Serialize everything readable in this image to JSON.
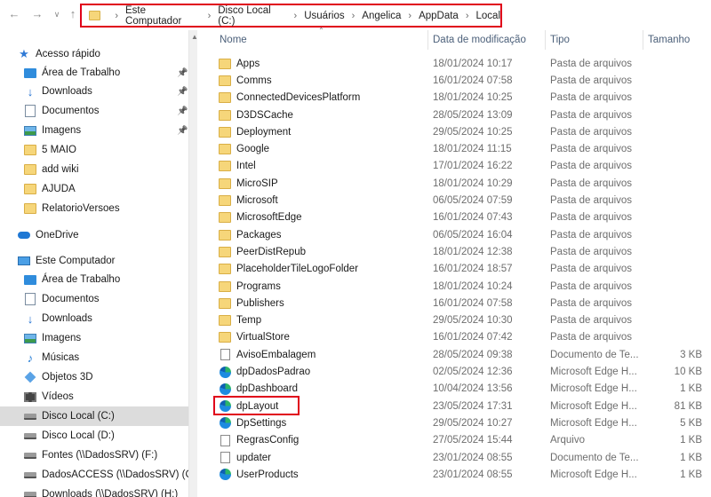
{
  "address": {
    "crumbs": [
      "Este Computador",
      "Disco Local (C:)",
      "Usuários",
      "Angelica",
      "AppData",
      "Local"
    ]
  },
  "nav": {
    "items": [
      {
        "label": "Acesso rápido",
        "icon": "star-icon",
        "indent": 0,
        "pinned": false
      },
      {
        "label": "Área de Trabalho",
        "icon": "desktop-icon",
        "indent": 1,
        "pinned": true
      },
      {
        "label": "Downloads",
        "icon": "downloads-icon",
        "indent": 1,
        "pinned": true
      },
      {
        "label": "Documentos",
        "icon": "documents-icon",
        "indent": 1,
        "pinned": true
      },
      {
        "label": "Imagens",
        "icon": "pictures-icon",
        "indent": 1,
        "pinned": true
      },
      {
        "label": "5 MAIO",
        "icon": "folder-icon",
        "indent": 1,
        "pinned": false
      },
      {
        "label": "add wiki",
        "icon": "folder-icon",
        "indent": 1,
        "pinned": false
      },
      {
        "label": "AJUDA",
        "icon": "folder-icon",
        "indent": 1,
        "pinned": false
      },
      {
        "label": "RelatorioVersoes",
        "icon": "folder-icon",
        "indent": 1,
        "pinned": false
      },
      {
        "label": "OneDrive",
        "icon": "onedrive-icon",
        "indent": 0,
        "pinned": false
      },
      {
        "label": "Este Computador",
        "icon": "computer-icon",
        "indent": 0,
        "pinned": false
      },
      {
        "label": "Área de Trabalho",
        "icon": "desktop-icon",
        "indent": 1,
        "pinned": false
      },
      {
        "label": "Documentos",
        "icon": "documents-icon",
        "indent": 1,
        "pinned": false
      },
      {
        "label": "Downloads",
        "icon": "downloads-icon",
        "indent": 1,
        "pinned": false
      },
      {
        "label": "Imagens",
        "icon": "pictures-icon",
        "indent": 1,
        "pinned": false
      },
      {
        "label": "Músicas",
        "icon": "music-icon",
        "indent": 1,
        "pinned": false
      },
      {
        "label": "Objetos 3D",
        "icon": "objects-3d-icon",
        "indent": 1,
        "pinned": false
      },
      {
        "label": "Vídeos",
        "icon": "videos-icon",
        "indent": 1,
        "pinned": false
      },
      {
        "label": "Disco Local (C:)",
        "icon": "drive-icon",
        "indent": 1,
        "pinned": false,
        "selected": true
      },
      {
        "label": "Disco Local (D:)",
        "icon": "drive-icon",
        "indent": 1,
        "pinned": false
      },
      {
        "label": "Fontes (\\\\DadosSRV) (F:)",
        "icon": "network-drive-icon",
        "indent": 1,
        "pinned": false
      },
      {
        "label": "DadosACCESS (\\\\DadosSRV) (G:)",
        "icon": "network-drive-icon",
        "indent": 1,
        "pinned": false
      },
      {
        "label": "Downloads (\\\\DadosSRV) (H:)",
        "icon": "network-drive-icon",
        "indent": 1,
        "pinned": false
      }
    ]
  },
  "columns": {
    "name": "Nome",
    "date": "Data de modificação",
    "type": "Tipo",
    "size": "Tamanho"
  },
  "files": [
    {
      "name": "Apps",
      "date": "18/01/2024 10:17",
      "type": "Pasta de arquivos",
      "size": "",
      "icon": "folder-icon"
    },
    {
      "name": "Comms",
      "date": "16/01/2024 07:58",
      "type": "Pasta de arquivos",
      "size": "",
      "icon": "folder-icon"
    },
    {
      "name": "ConnectedDevicesPlatform",
      "date": "18/01/2024 10:25",
      "type": "Pasta de arquivos",
      "size": "",
      "icon": "folder-icon"
    },
    {
      "name": "D3DSCache",
      "date": "28/05/2024 13:09",
      "type": "Pasta de arquivos",
      "size": "",
      "icon": "folder-icon"
    },
    {
      "name": "Deployment",
      "date": "29/05/2024 10:25",
      "type": "Pasta de arquivos",
      "size": "",
      "icon": "folder-icon"
    },
    {
      "name": "Google",
      "date": "18/01/2024 11:15",
      "type": "Pasta de arquivos",
      "size": "",
      "icon": "folder-icon"
    },
    {
      "name": "Intel",
      "date": "17/01/2024 16:22",
      "type": "Pasta de arquivos",
      "size": "",
      "icon": "folder-icon"
    },
    {
      "name": "MicroSIP",
      "date": "18/01/2024 10:29",
      "type": "Pasta de arquivos",
      "size": "",
      "icon": "folder-icon"
    },
    {
      "name": "Microsoft",
      "date": "06/05/2024 07:59",
      "type": "Pasta de arquivos",
      "size": "",
      "icon": "folder-icon"
    },
    {
      "name": "MicrosoftEdge",
      "date": "16/01/2024 07:43",
      "type": "Pasta de arquivos",
      "size": "",
      "icon": "folder-icon"
    },
    {
      "name": "Packages",
      "date": "06/05/2024 16:04",
      "type": "Pasta de arquivos",
      "size": "",
      "icon": "folder-icon"
    },
    {
      "name": "PeerDistRepub",
      "date": "18/01/2024 12:38",
      "type": "Pasta de arquivos",
      "size": "",
      "icon": "folder-icon"
    },
    {
      "name": "PlaceholderTileLogoFolder",
      "date": "16/01/2024 18:57",
      "type": "Pasta de arquivos",
      "size": "",
      "icon": "folder-icon"
    },
    {
      "name": "Programs",
      "date": "18/01/2024 10:24",
      "type": "Pasta de arquivos",
      "size": "",
      "icon": "folder-icon"
    },
    {
      "name": "Publishers",
      "date": "16/01/2024 07:58",
      "type": "Pasta de arquivos",
      "size": "",
      "icon": "folder-icon"
    },
    {
      "name": "Temp",
      "date": "29/05/2024 10:30",
      "type": "Pasta de arquivos",
      "size": "",
      "icon": "folder-icon"
    },
    {
      "name": "VirtualStore",
      "date": "16/01/2024 07:42",
      "type": "Pasta de arquivos",
      "size": "",
      "icon": "folder-icon"
    },
    {
      "name": "AvisoEmbalagem",
      "date": "28/05/2024 09:38",
      "type": "Documento de Te...",
      "size": "3 KB",
      "icon": "text-file-icon"
    },
    {
      "name": "dpDadosPadrao",
      "date": "02/05/2024 12:36",
      "type": "Microsoft Edge H...",
      "size": "10 KB",
      "icon": "edge-icon"
    },
    {
      "name": "dpDashboard",
      "date": "10/04/2024 13:56",
      "type": "Microsoft Edge H...",
      "size": "1 KB",
      "icon": "edge-icon"
    },
    {
      "name": "dpLayout",
      "date": "23/05/2024 17:31",
      "type": "Microsoft Edge H...",
      "size": "81 KB",
      "icon": "edge-icon"
    },
    {
      "name": "DpSettings",
      "date": "29/05/2024 10:27",
      "type": "Microsoft Edge H...",
      "size": "5 KB",
      "icon": "edge-icon"
    },
    {
      "name": "RegrasConfig",
      "date": "27/05/2024 15:44",
      "type": "Arquivo",
      "size": "1 KB",
      "icon": "file-icon"
    },
    {
      "name": "updater",
      "date": "23/01/2024 08:55",
      "type": "Documento de Te...",
      "size": "1 KB",
      "icon": "text-file-icon"
    },
    {
      "name": "UserProducts",
      "date": "23/01/2024 08:55",
      "type": "Microsoft Edge H...",
      "size": "1 KB",
      "icon": "edge-icon"
    }
  ],
  "colors": {
    "highlight_border": "#e0001a",
    "folder": "#f6d67a",
    "selected_nav": "#dcdcdc"
  }
}
